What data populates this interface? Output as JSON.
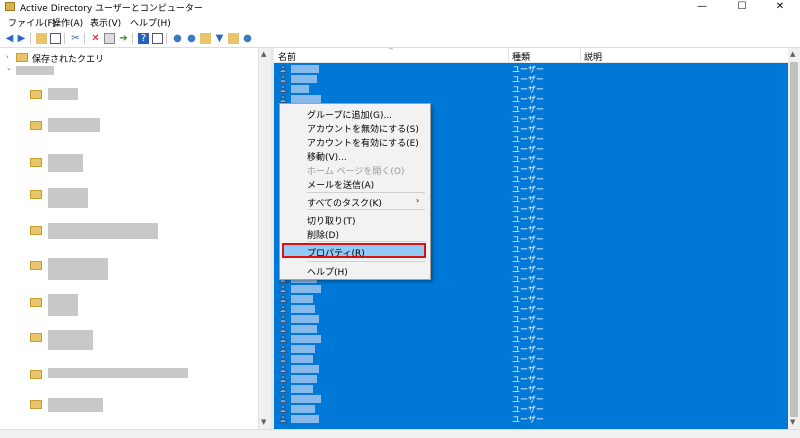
{
  "window": {
    "title": "Active Directory ユーザーとコンピューター",
    "min": "—",
    "max": "☐",
    "close": "✕"
  },
  "menu": [
    "ファイル(F)",
    "操作(A)",
    "表示(V)",
    "ヘルプ(H)"
  ],
  "toolbar_icons": [
    "back-icon",
    "forward-icon",
    "folder-up-icon",
    "console-tree-icon",
    "cut-icon",
    "delete-icon",
    "properties-icon",
    "export-icon",
    "help-icon",
    "toggle-pane-icon",
    "add-user-icon",
    "add-group-icon",
    "add-ou-icon",
    "filter-icon",
    "find-icon",
    "delegate-icon"
  ],
  "tree": {
    "saved_queries": "保存されたクエリ"
  },
  "list": {
    "columns": [
      "名前",
      "種類",
      "説明"
    ],
    "row_type": "ユーザー",
    "row_count": 36
  },
  "context_menu": {
    "items": [
      {
        "label": "グループに追加(G)..."
      },
      {
        "label": "アカウントを無効にする(S)"
      },
      {
        "label": "アカウントを有効にする(E)"
      },
      {
        "label": "移動(V)..."
      },
      {
        "label": "ホーム ページを開く(O)",
        "disabled": true
      },
      {
        "label": "メールを送信(A)"
      },
      {
        "label": "すべてのタスク(K)",
        "submenu": true
      },
      {
        "label": "切り取り(T)"
      },
      {
        "label": "削除(D)"
      },
      {
        "label": "プロパティ(R)",
        "highlighted": true
      },
      {
        "label": "ヘルプ(H)"
      }
    ]
  },
  "colors": {
    "selection": "#0078d7",
    "highlight_border": "#e01010",
    "highlight_fill": "#91c9f7"
  }
}
